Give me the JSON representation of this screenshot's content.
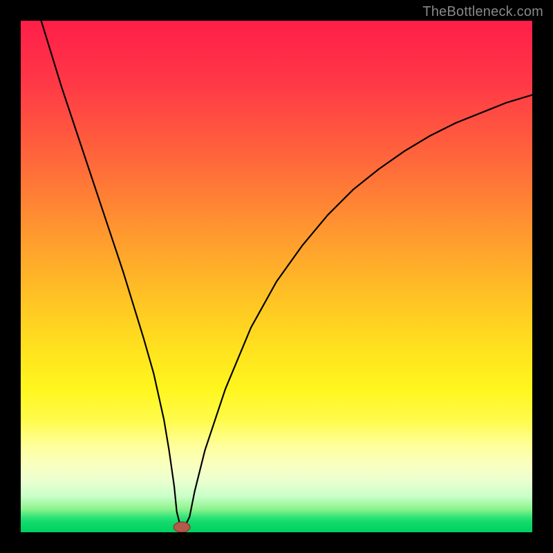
{
  "watermark": "TheBottleneck.com",
  "colors": {
    "frame": "#000000",
    "curve": "#000000",
    "marker_fill": "#b35a4a",
    "marker_stroke": "#8a3f34"
  },
  "chart_data": {
    "type": "line",
    "title": "",
    "xlabel": "",
    "ylabel": "",
    "xlim": [
      0,
      100
    ],
    "ylim": [
      0,
      100
    ],
    "grid": false,
    "legend": false,
    "series": [
      {
        "name": "curve",
        "x": [
          4,
          8,
          12,
          16,
          20,
          24,
          26,
          28,
          29,
          30,
          30.5,
          31,
          31.5,
          32,
          33,
          34,
          36,
          40,
          45,
          50,
          55,
          60,
          65,
          70,
          75,
          80,
          85,
          90,
          95,
          100
        ],
        "y": [
          100,
          87,
          75,
          63,
          51,
          38,
          31,
          22,
          16,
          9,
          4,
          2,
          1,
          1,
          3,
          8,
          16,
          28,
          40,
          49,
          56,
          62,
          67,
          71,
          74.5,
          77.5,
          80,
          82,
          84,
          85.5
        ]
      }
    ],
    "marker": {
      "x": 31.5,
      "y": 1,
      "rx": 1.6,
      "ry": 1.0
    }
  }
}
